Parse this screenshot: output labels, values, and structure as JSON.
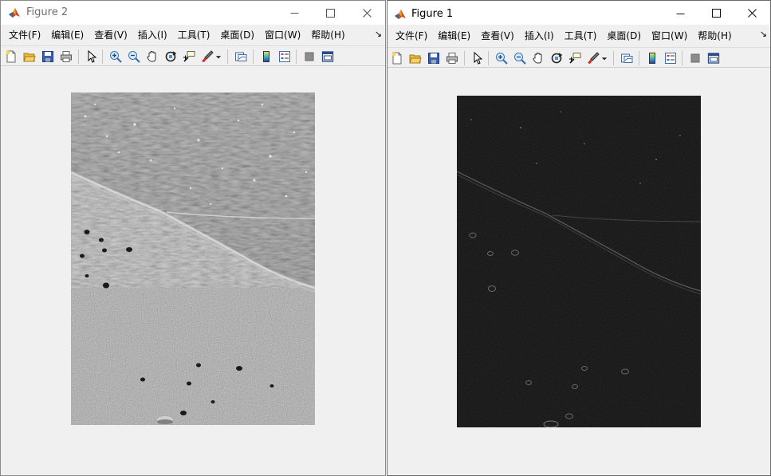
{
  "windows": [
    {
      "id": "win2",
      "title": "Figure 2",
      "menu": [
        "文件(F)",
        "编辑(E)",
        "查看(V)",
        "插入(I)",
        "工具(T)",
        "桌面(D)",
        "窗口(W)",
        "帮助(H)"
      ],
      "menu_more": "↘"
    },
    {
      "id": "win1",
      "title": "Figure 1",
      "menu": [
        "文件(F)",
        "编辑(E)",
        "查看(V)",
        "插入(I)",
        "工具(T)",
        "桌面(D)",
        "窗口(W)",
        "帮助(H)"
      ],
      "menu_more": "↘"
    }
  ],
  "caption_buttons": {
    "minimize": "—",
    "maximize": "☐",
    "close": "✕"
  },
  "toolbar_icons": [
    "new-figure-icon",
    "open-file-icon",
    "save-icon",
    "print-icon",
    "pointer-icon",
    "zoom-in-icon",
    "zoom-out-icon",
    "pan-icon",
    "rotate-3d-icon",
    "data-cursor-icon",
    "brush-icon",
    "dropdown-arrow-icon",
    "link-plot-icon",
    "colorbar-icon",
    "legend-icon",
    "hide-plot-tools-icon",
    "show-plot-tools-icon"
  ],
  "colors": {
    "window_bg": "#f0f0f0",
    "title_bg": "#ffffff",
    "inactive_title": "#6e6e6e",
    "active_title": "#000000"
  }
}
